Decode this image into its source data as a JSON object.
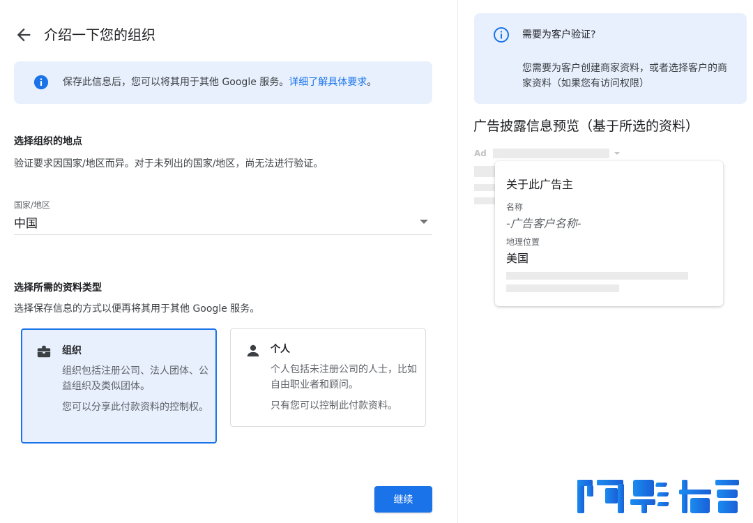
{
  "header": {
    "title": "介绍一下您的组织"
  },
  "banner": {
    "text": "保存此信息后，您可以将其用于其他 Google 服务。",
    "link": "详细了解具体要求",
    "tail": "。"
  },
  "location": {
    "title": "选择组织的地点",
    "description": "验证要求因国家/地区而异。对于未列出的国家/地区，尚无法进行验证。",
    "field_label": "国家/地区",
    "selected_value": "中国"
  },
  "profile_type": {
    "title": "选择所需的资料类型",
    "description": "选择保存信息的方式以便再将其用于其他 Google 服务。",
    "cards": [
      {
        "title": "组织",
        "description": "组织包括注册公司、法人团体、公益组织及类似团体。",
        "note": "您可以分享此付款资料的控制权。",
        "selected": true
      },
      {
        "title": "个人",
        "description": "个人包括未注册公司的人士，比如自由职业者和顾问。",
        "note": "只有您可以控制此付款资料。",
        "selected": false
      }
    ]
  },
  "continue_label": "继续",
  "verify": {
    "title": "需要为客户验证?",
    "text": "您需要为客户创建商家资料，或者选择客户的商家资料（如果您有访问权限）"
  },
  "preview": {
    "title": "广告披露信息预览（基于所选的资料）",
    "ad_label": "Ad",
    "popup": {
      "title": "关于此广告主",
      "name_label": "名称",
      "name_value": "-广告客户名称-",
      "geo_label": "地理位置",
      "geo_value": "美国"
    }
  },
  "colors": {
    "accent": "#1a73e8",
    "banner_bg": "#e8f0fe",
    "watermark": "#1a6fe0"
  },
  "icons": {
    "back": "arrow-left-icon",
    "info": "info-filled-icon",
    "info_outline": "info-outline-icon",
    "organization": "briefcase-icon",
    "person": "person-icon"
  }
}
